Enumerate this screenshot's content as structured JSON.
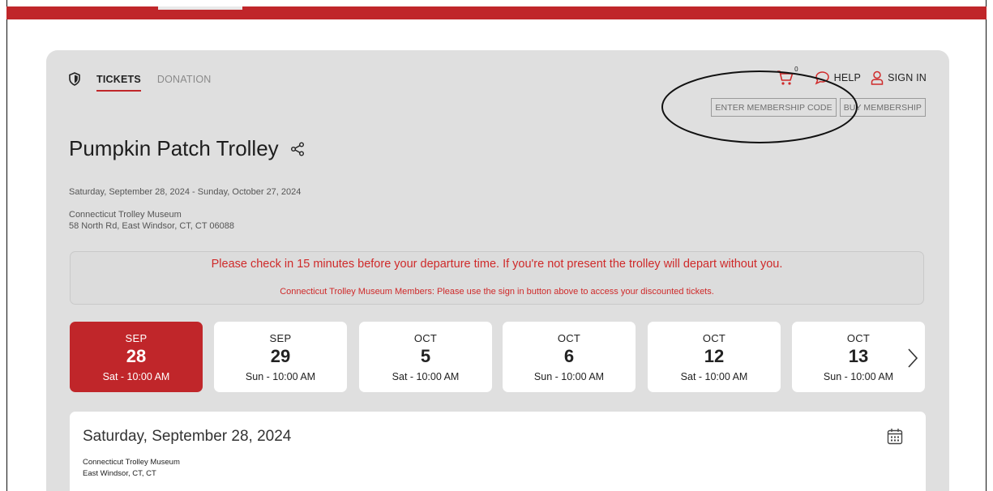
{
  "nav": {
    "tabs": [
      {
        "label": "TICKETS",
        "active": true
      },
      {
        "label": "DONATION",
        "active": false
      }
    ]
  },
  "tools": {
    "cart_count": "0",
    "help_label": "HELP",
    "sign_in_label": "SIGN IN",
    "enter_membership_label": "ENTER MEMBERSHIP CODE",
    "buy_membership_label": "BUY MEMBERSHIP"
  },
  "event": {
    "title": "Pumpkin Patch Trolley",
    "date_range": "Saturday, September 28, 2024 - Sunday, October 27, 2024",
    "venue_name": "Connecticut Trolley Museum",
    "venue_address": "58 North Rd, East Windsor, CT, CT 06088"
  },
  "notice": {
    "main": "Please check in 15 minutes before your departure time. If you're not present the trolley will depart without you.",
    "sub": "Connecticut Trolley Museum Members: Please use the sign in button above to access your discounted tickets."
  },
  "dates": [
    {
      "month": "SEP",
      "day": "28",
      "time": "Sat - 10:00 AM",
      "selected": true
    },
    {
      "month": "SEP",
      "day": "29",
      "time": "Sun - 10:00 AM",
      "selected": false
    },
    {
      "month": "OCT",
      "day": "5",
      "time": "Sat - 10:00 AM",
      "selected": false
    },
    {
      "month": "OCT",
      "day": "6",
      "time": "Sun - 10:00 AM",
      "selected": false
    },
    {
      "month": "OCT",
      "day": "12",
      "time": "Sat - 10:00 AM",
      "selected": false
    },
    {
      "month": "OCT",
      "day": "13",
      "time": "Sun - 10:00 AM",
      "selected": false
    }
  ],
  "detail": {
    "title": "Saturday, September 28, 2024",
    "venue_name": "Connecticut Trolley Museum",
    "venue_city": "East Windsor, CT, CT"
  },
  "colors": {
    "brand_red": "#c0262a",
    "notice_red": "#cf2a2a",
    "panel_gray": "#dfdfdf"
  },
  "icons": [
    "shield-icon",
    "cart-icon",
    "chat-bubble-icon",
    "user-icon",
    "share-icon",
    "chevron-right-icon",
    "calendar-icon"
  ]
}
